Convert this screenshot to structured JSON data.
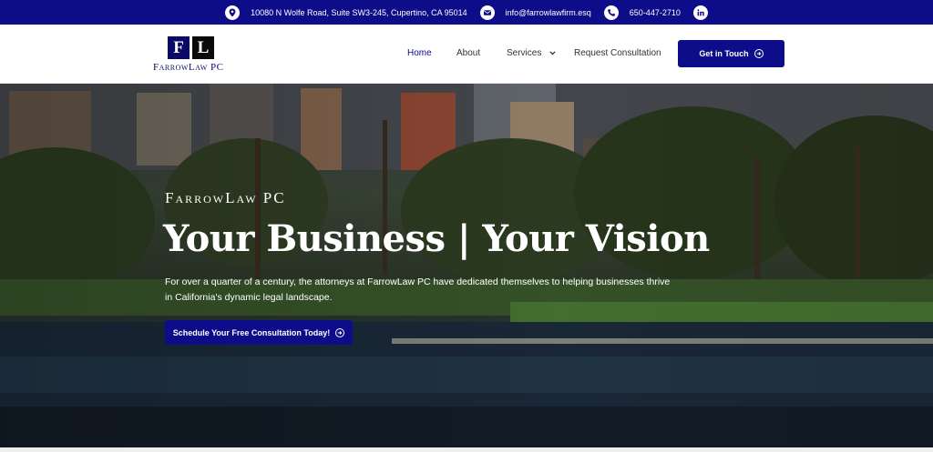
{
  "colors": {
    "brand": "#0d0d8a",
    "white": "#ffffff"
  },
  "topbar": {
    "address": "10080 N Wolfe Road, Suite SW3-245, Cupertino, CA 95014",
    "email": "info@farrowlawfirm.esq",
    "phone": "650-447-2710",
    "icons": [
      "location-pin-icon",
      "envelope-icon",
      "phone-icon",
      "linkedin-icon"
    ]
  },
  "logo": {
    "letter_1": "F",
    "letter_2": "L",
    "name": "FarrowLaw PC"
  },
  "nav": {
    "items": [
      {
        "label": "Home",
        "active": true
      },
      {
        "label": "About"
      },
      {
        "label": "Services"
      },
      {
        "label": "Request Consultation"
      }
    ],
    "cta_label": "Get in Touch"
  },
  "hero": {
    "eyebrow": "FarrowLaw PC",
    "title": "Your Business | Your Vision",
    "text": "For over a quarter of a century, the attorneys at FarrowLaw PC have dedicated themselves to helping businesses thrive in California's dynamic legal landscape.",
    "cta_label": "Schedule Your Free Consultation Today!"
  }
}
